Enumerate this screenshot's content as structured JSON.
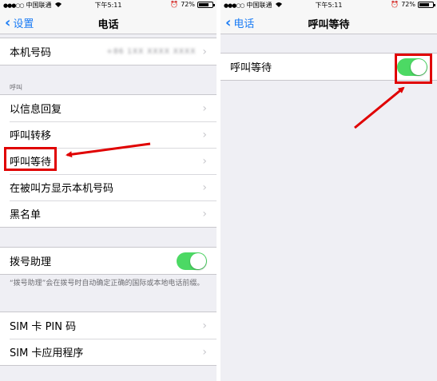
{
  "left": {
    "status": {
      "carrier": "中国联通",
      "time": "下午5:11",
      "battery": "72%"
    },
    "nav": {
      "back": "设置",
      "title": "电话"
    },
    "my_number": {
      "label": "本机号码",
      "value": "+86 1XX XXXX XXXX"
    },
    "calls_section": {
      "header": "呼叫",
      "items": [
        {
          "label": "以信息回复"
        },
        {
          "label": "呼叫转移"
        },
        {
          "label": "呼叫等待"
        },
        {
          "label": "在被叫方显示本机号码"
        },
        {
          "label": "黑名单"
        }
      ]
    },
    "dial_assist": {
      "label": "拨号助理",
      "on": true,
      "footnote": "“拨号助理”会在拨号时自动确定正确的国际或本地电话前缀。"
    },
    "sim": {
      "items": [
        {
          "label": "SIM 卡 PIN 码"
        },
        {
          "label": "SIM 卡应用程序"
        }
      ]
    }
  },
  "right": {
    "status": {
      "carrier": "中国联通",
      "time": "下午5:11",
      "battery": "72%"
    },
    "nav": {
      "back": "电话",
      "title": "呼叫等待"
    },
    "call_waiting": {
      "label": "呼叫等待",
      "on": true
    }
  },
  "colors": {
    "accent": "#1b7cf5",
    "toggle_on": "#4cd964",
    "annotation": "#e00000"
  }
}
